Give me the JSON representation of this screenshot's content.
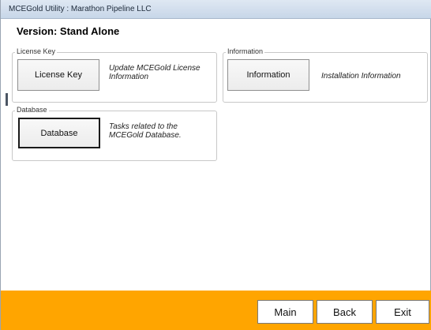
{
  "window": {
    "title": "MCEGold Utility : Marathon Pipeline LLC"
  },
  "header": {
    "version_label": "Version: Stand Alone"
  },
  "groups": {
    "license_key": {
      "legend": "License Key",
      "button_label": "License Key",
      "description": "Update MCEGold License Information"
    },
    "information": {
      "legend": "Information",
      "button_label": "Information",
      "description": "Installation Information"
    },
    "database": {
      "legend": "Database",
      "button_label": "Database",
      "description": "Tasks related to the MCEGold Database."
    }
  },
  "footer": {
    "main_label": "Main",
    "back_label": "Back",
    "exit_label": "Exit"
  },
  "colors": {
    "footer_bar": "#ffa500",
    "window_background": "#ffffff"
  }
}
